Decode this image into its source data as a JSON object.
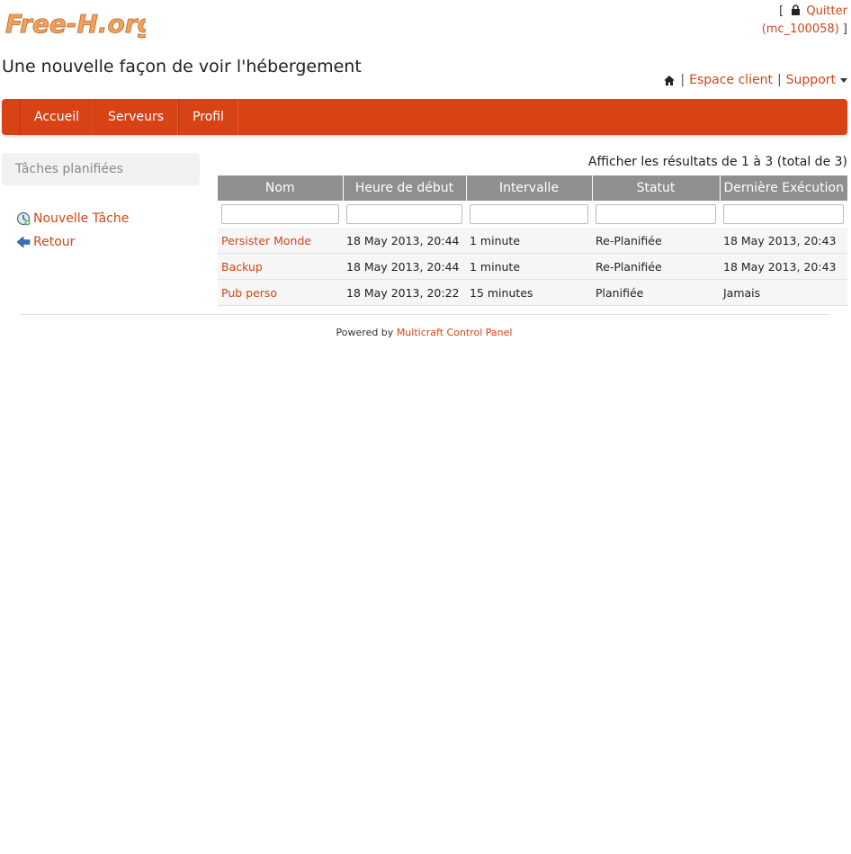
{
  "header": {
    "logo_text": "Free-H.org",
    "tagline": "Une nouvelle façon de voir l'hébergement",
    "bracket_open": "[",
    "bracket_close": "]",
    "logout_label": "Quitter",
    "username": "(mc_100058)"
  },
  "toplinks": {
    "separator": "|",
    "espace_client": "Espace client",
    "support": "Support"
  },
  "navbar": {
    "items": [
      "Accueil",
      "Serveurs",
      "Profil"
    ]
  },
  "sidebar": {
    "title": "Tâches planifiées",
    "items": [
      {
        "label": "Nouvelle Tâche",
        "icon": "clock-add-icon"
      },
      {
        "label": "Retour",
        "icon": "arrow-left-icon"
      }
    ]
  },
  "grid": {
    "summary": "Afficher les résultats de 1 à 3 (total de 3)",
    "columns": [
      "Nom",
      "Heure de début",
      "Intervalle",
      "Statut",
      "Dernière Exécution"
    ],
    "rows": [
      [
        "Persister Monde",
        "18 May 2013, 20:44",
        "1 minute",
        "Re-Planifiée",
        "18 May 2013, 20:43"
      ],
      [
        "Backup",
        "18 May 2013, 20:44",
        "1 minute",
        "Re-Planifiée",
        "18 May 2013, 20:43"
      ],
      [
        "Pub perso",
        "18 May 2013, 20:22",
        "15 minutes",
        "Planifiée",
        "Jamais"
      ]
    ]
  },
  "footer": {
    "powered_by": "Powered by",
    "link": "Multicraft Control Panel"
  },
  "colors": {
    "accent": "#d84315",
    "link": "#d24517",
    "header_bg": "#8f8f8f"
  }
}
